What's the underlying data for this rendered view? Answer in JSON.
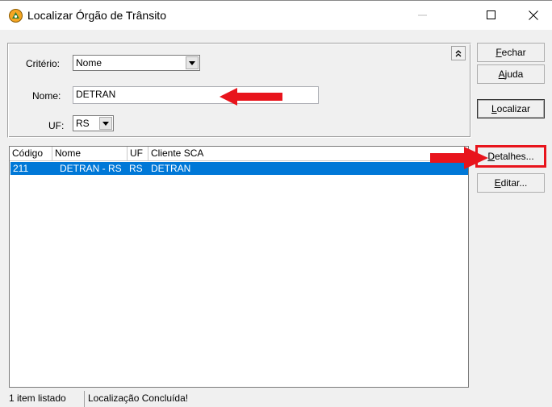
{
  "window": {
    "title": "Localizar Órgão de Trânsito",
    "minimize_glyph": "—",
    "maximize_glyph": "☐",
    "close_glyph": "✕"
  },
  "criteria": {
    "criterio_label": "Critério:",
    "criterio_value": "Nome",
    "nome_label": "Nome:",
    "nome_value": "DETRAN",
    "uf_label": "UF:",
    "uf_value": "RS",
    "collapse_glyph": "⌃"
  },
  "buttons": {
    "fechar": {
      "label_mnemonic": "F",
      "label_rest": "echar"
    },
    "ajuda": {
      "label_mnemonic": "A",
      "label_rest": "juda"
    },
    "localizar": {
      "label_mnemonic": "L",
      "label_rest": "ocalizar"
    },
    "detalhes": {
      "label_mnemonic": "D",
      "label_rest": "etalhes..."
    },
    "editar": {
      "label_mnemonic": "E",
      "label_rest": "ditar..."
    }
  },
  "results": {
    "columns": [
      "Código",
      "Nome",
      "UF",
      "Cliente SCA"
    ],
    "rows": [
      {
        "codigo": "211",
        "nome": "DETRAN - RS",
        "uf": "RS",
        "cliente_sca": "DETRAN",
        "selected": true
      }
    ]
  },
  "status": {
    "count_text": "1 item listado",
    "message": "Localização Concluída!"
  },
  "colors": {
    "selection": "#0078d7",
    "annotation_red": "#e8141c"
  }
}
